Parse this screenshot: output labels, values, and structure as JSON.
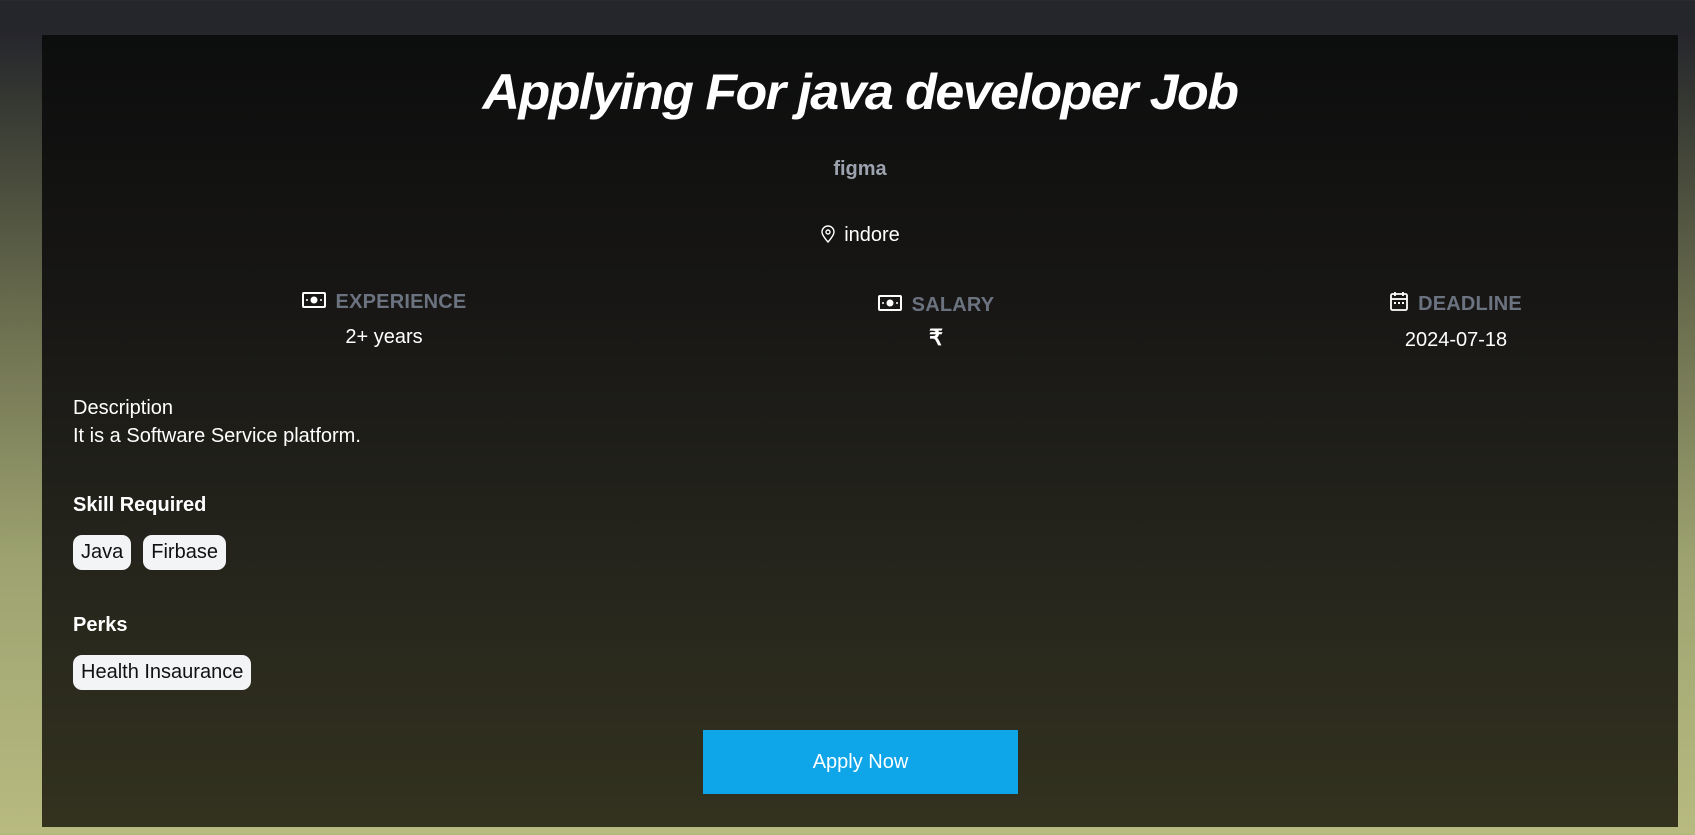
{
  "job": {
    "title": "Applying For java developer Job",
    "company": "figma",
    "location": "indore"
  },
  "stats": {
    "experience": {
      "label": "EXPERIENCE",
      "value": "2+ years",
      "icon": "money-bill-icon"
    },
    "salary": {
      "label": "SALARY",
      "value": "₹",
      "icon": "money-bill-icon"
    },
    "deadline": {
      "label": "DEADLINE",
      "value": "2024-07-18",
      "icon": "calendar-icon"
    }
  },
  "description": {
    "label": "Description",
    "text": "It is a Software Service platform."
  },
  "skills": {
    "heading": "Skill Required",
    "items": [
      "Java",
      "Firbase"
    ]
  },
  "perks": {
    "heading": "Perks",
    "items": [
      "Health Insaurance"
    ]
  },
  "actions": {
    "apply_label": "Apply Now"
  },
  "colors": {
    "accent": "#0ea5e9",
    "muted": "#6b7280",
    "company": "#9ca3af"
  }
}
